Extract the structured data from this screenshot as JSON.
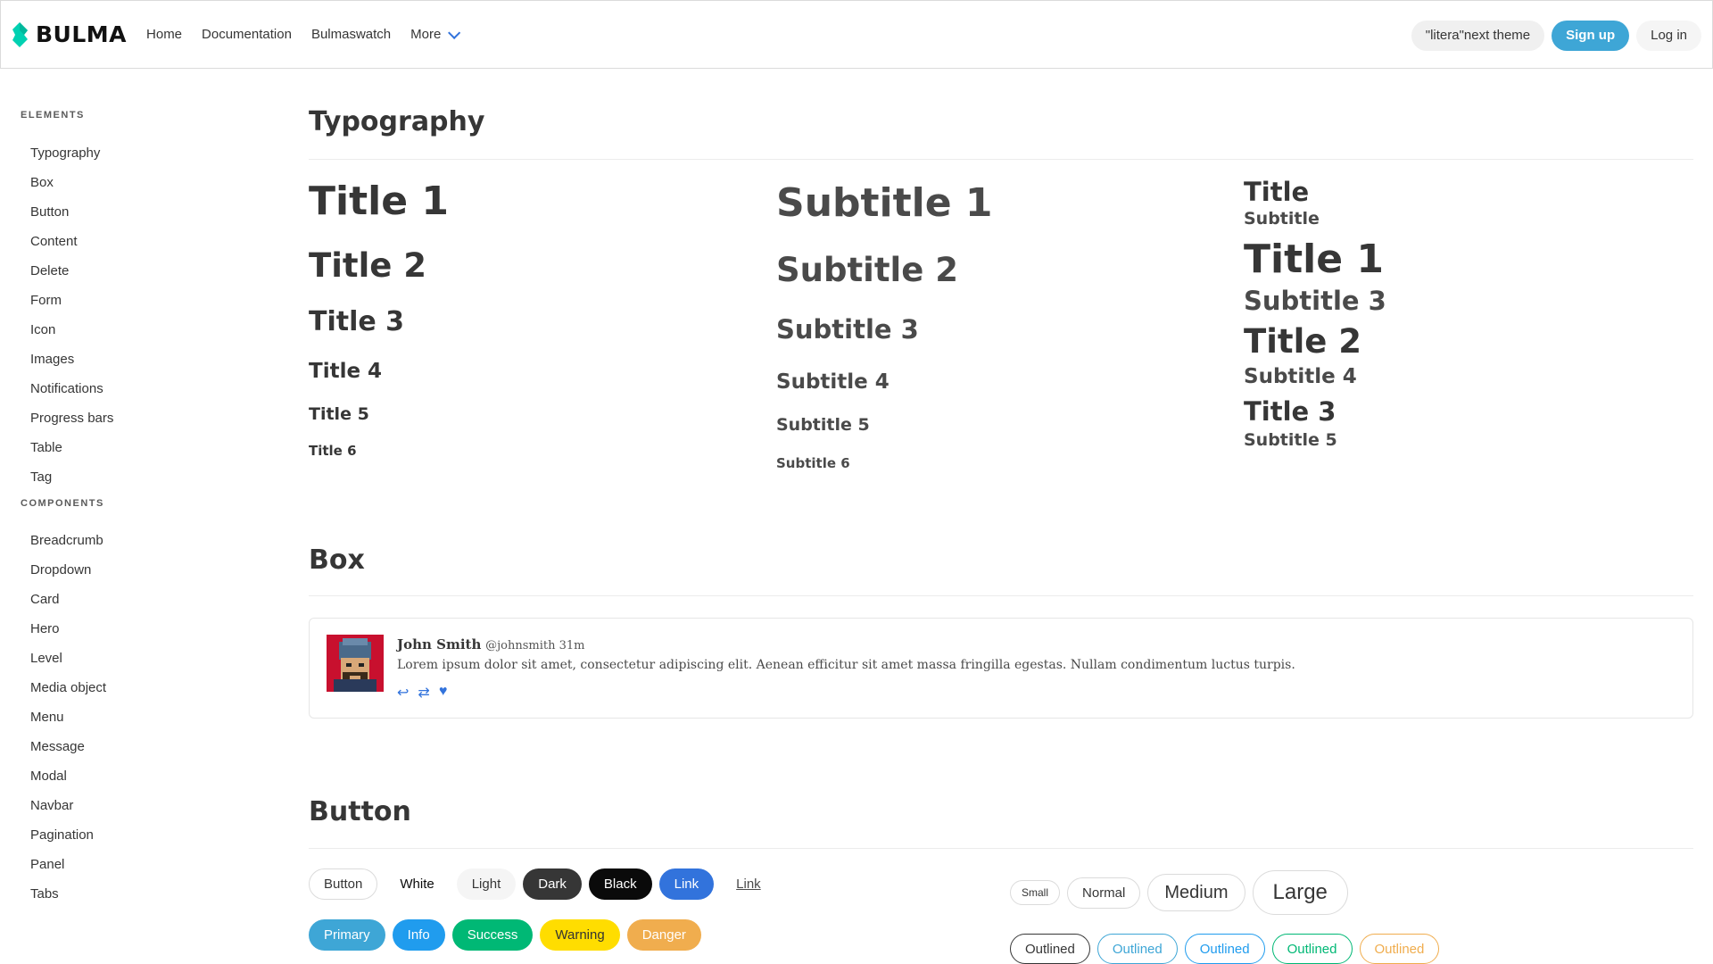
{
  "navbar": {
    "brand": "BULMA",
    "items": [
      "Home",
      "Documentation",
      "Bulmaswatch",
      "More"
    ],
    "theme_button": "\"litera\"next theme",
    "signup": "Sign up",
    "login": "Log in"
  },
  "sidebar": {
    "elements_label": "ELEMENTS",
    "elements": [
      "Typography",
      "Box",
      "Button",
      "Content",
      "Delete",
      "Form",
      "Icon",
      "Images",
      "Notifications",
      "Progress bars",
      "Table",
      "Tag"
    ],
    "components_label": "COMPONENTS",
    "components": [
      "Breadcrumb",
      "Dropdown",
      "Card",
      "Hero",
      "Level",
      "Media object",
      "Menu",
      "Message",
      "Modal",
      "Navbar",
      "Pagination",
      "Panel",
      "Tabs"
    ]
  },
  "typography": {
    "title": "Typography",
    "titles": [
      "Title 1",
      "Title 2",
      "Title 3",
      "Title 4",
      "Title 5",
      "Title 6"
    ],
    "subtitles": [
      "Subtitle 1",
      "Subtitle 2",
      "Subtitle 3",
      "Subtitle 4",
      "Subtitle 5",
      "Subtitle 6"
    ],
    "combo": [
      "Title",
      "Subtitle",
      "Title 1",
      "Subtitle 3",
      "Title 2",
      "Subtitle 4",
      "Title 3",
      "Subtitle 5"
    ]
  },
  "box": {
    "title": "Box",
    "name": "John Smith",
    "handle": "@johnsmith 31m",
    "text": "Lorem ipsum dolor sit amet, consectetur adipiscing elit. Aenean efficitur sit amet massa fringilla egestas. Nullam condimentum luctus turpis."
  },
  "buttons": {
    "title": "Button",
    "row1": [
      "Button",
      "White",
      "Light",
      "Dark",
      "Black",
      "Link",
      "Link"
    ],
    "row2": [
      "Primary",
      "Info",
      "Success",
      "Warning",
      "Danger"
    ],
    "sizes": [
      "Small",
      "Normal",
      "Medium",
      "Large"
    ],
    "outlined": [
      "Outlined",
      "Outlined",
      "Outlined",
      "Outlined",
      "Outlined"
    ]
  }
}
